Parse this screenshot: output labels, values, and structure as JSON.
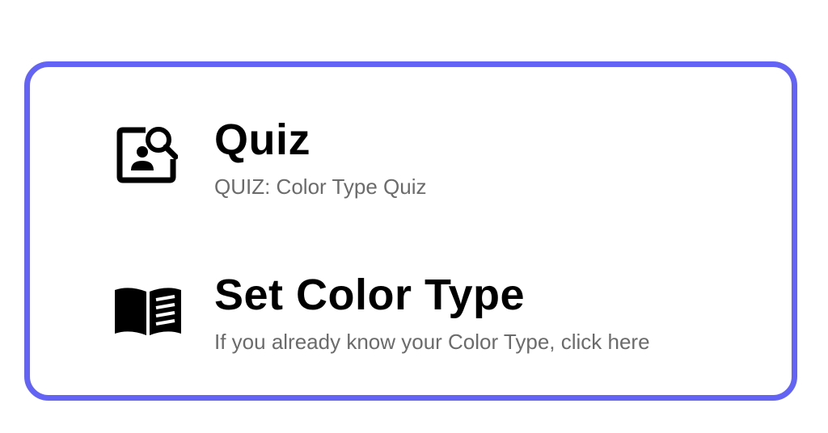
{
  "theme": {
    "accent_border": "#6363f5",
    "title_color": "#000000",
    "subtitle_color": "#6b6b6b"
  },
  "menu": {
    "items": [
      {
        "icon": "quiz-search-person-icon",
        "title": "Quiz",
        "subtitle": "QUIZ: Color Type Quiz"
      },
      {
        "icon": "open-book-icon",
        "title": "Set Color Type",
        "subtitle": "If you already know your Color Type, click here"
      }
    ]
  }
}
